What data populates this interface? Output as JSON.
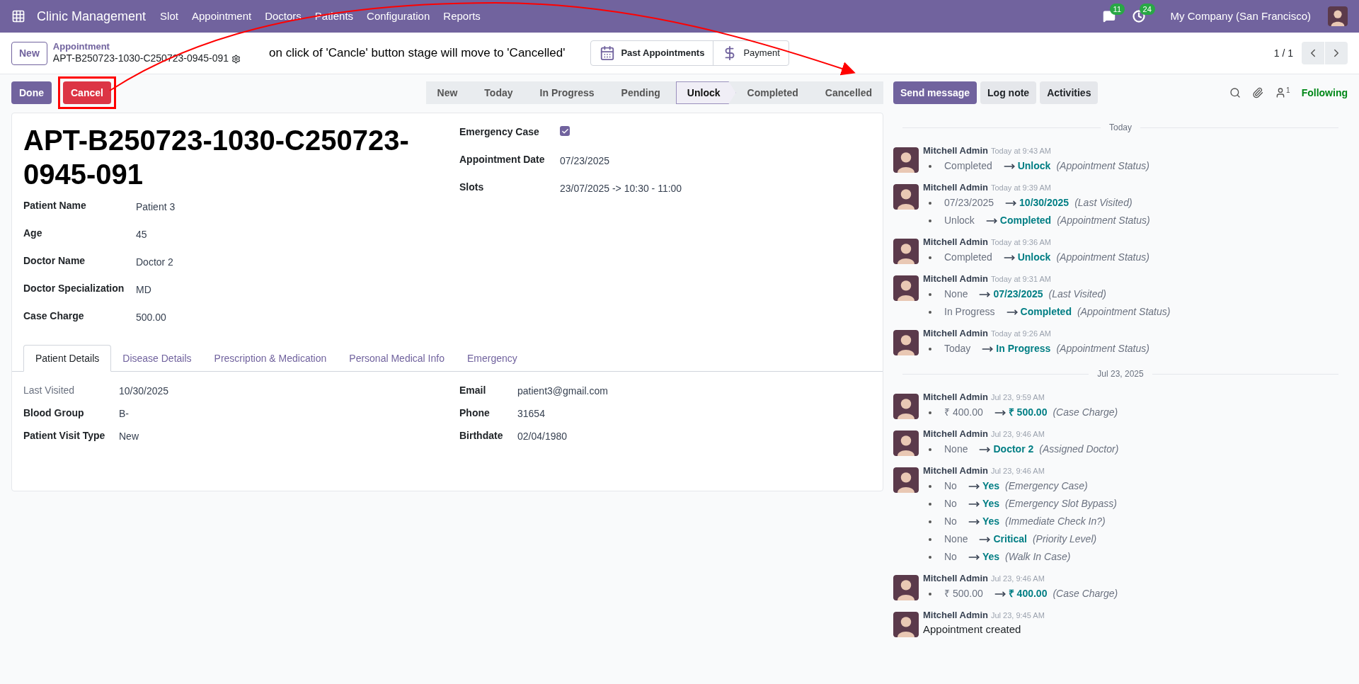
{
  "navbar": {
    "app_name": "Clinic Management",
    "menu": [
      "Slot",
      "Appointment",
      "Doctors",
      "Patients",
      "Configuration",
      "Reports"
    ],
    "messages_count": "11",
    "activities_count": "24",
    "company": "My Company (San Francisco)"
  },
  "breadcrumb": {
    "new_button": "New",
    "parent": "Appointment",
    "record": "APT-B250723-1030-C250723-0945-091"
  },
  "annotation": {
    "text": "on click of 'Cancle' button stage will move to 'Cancelled'"
  },
  "smart_buttons": [
    {
      "label": "Past Appointments",
      "kind": "calendar"
    },
    {
      "label": "Payment",
      "kind": "dollar"
    }
  ],
  "pager": "1 / 1",
  "actions": [
    {
      "label": "Done",
      "kind": "primary",
      "highlighted": false
    },
    {
      "label": "Cancel",
      "kind": "danger",
      "highlighted": true
    }
  ],
  "stages": [
    {
      "label": "New",
      "selected": false
    },
    {
      "label": "Today",
      "selected": false
    },
    {
      "label": "In Progress",
      "selected": false
    },
    {
      "label": "Pending",
      "selected": false
    },
    {
      "label": "Unlock",
      "selected": true
    },
    {
      "label": "Completed",
      "selected": false
    },
    {
      "label": "Cancelled",
      "selected": false
    }
  ],
  "form": {
    "title": "APT-B250723-1030-C250723-0945-091",
    "left_fields": [
      {
        "label": "Patient Name",
        "value": "Patient 3",
        "kind": "text"
      },
      {
        "label": "Age",
        "value": "45",
        "kind": "text"
      },
      {
        "label": "Doctor Name",
        "value": "Doctor 2",
        "kind": "text"
      },
      {
        "label": "Doctor Specialization",
        "value": "MD",
        "kind": "text"
      },
      {
        "label": "Case Charge",
        "value": "500.00",
        "kind": "text"
      }
    ],
    "right_fields": [
      {
        "label": "Emergency Case",
        "kind": "checkbox",
        "checked": true
      },
      {
        "label": "Appointment Date",
        "value": "07/23/2025",
        "kind": "text"
      },
      {
        "label": "Slots",
        "value": "23/07/2025 -> 10:30 - 11:00",
        "kind": "text"
      }
    ],
    "tabs": [
      {
        "label": "Patient Details",
        "selected": true
      },
      {
        "label": "Disease Details",
        "selected": false
      },
      {
        "label": "Prescription & Medication",
        "selected": false
      },
      {
        "label": "Personal Medical Info",
        "selected": false
      },
      {
        "label": "Emergency",
        "selected": false
      }
    ],
    "tab_left_fields": [
      {
        "label": "Last Visited",
        "value": "10/30/2025",
        "muted": true
      },
      {
        "label": "Blood Group",
        "value": "B-",
        "muted": false
      },
      {
        "label": "Patient Visit Type",
        "value": "New",
        "muted": false
      }
    ],
    "tab_right_fields": [
      {
        "label": "Email",
        "value": "patient3@gmail.com",
        "muted": false
      },
      {
        "label": "Phone",
        "value": "31654",
        "muted": false
      },
      {
        "label": "Birthdate",
        "value": "02/04/1980",
        "muted": false
      }
    ]
  },
  "chatter": {
    "buttons": [
      {
        "label": "Send message",
        "kind": "primary"
      },
      {
        "label": "Log note",
        "kind": "secondary"
      },
      {
        "label": "Activities",
        "kind": "secondary"
      }
    ],
    "followers_count": "1",
    "following": "Following",
    "groups": [
      {
        "date": "Today",
        "messages": [
          {
            "author": "Mitchell Admin",
            "time": "Today at 9:43 AM",
            "changes": [
              {
                "old": "Completed",
                "new": "Unlock",
                "field": "(Appointment Status)"
              }
            ]
          },
          {
            "author": "Mitchell Admin",
            "time": "Today at 9:39 AM",
            "changes": [
              {
                "old": "07/23/2025",
                "new": "10/30/2025",
                "field": "(Last Visited)"
              },
              {
                "old": "Unlock",
                "new": "Completed",
                "field": "(Appointment Status)"
              }
            ]
          },
          {
            "author": "Mitchell Admin",
            "time": "Today at 9:36 AM",
            "changes": [
              {
                "old": "Completed",
                "new": "Unlock",
                "field": "(Appointment Status)"
              }
            ]
          },
          {
            "author": "Mitchell Admin",
            "time": "Today at 9:31 AM",
            "changes": [
              {
                "old": "None",
                "new": "07/23/2025",
                "field": "(Last Visited)"
              },
              {
                "old": "In Progress",
                "new": "Completed",
                "field": "(Appointment Status)"
              }
            ]
          },
          {
            "author": "Mitchell Admin",
            "time": "Today at 9:26 AM",
            "changes": [
              {
                "old": "Today",
                "new": "In Progress",
                "field": "(Appointment Status)"
              }
            ]
          }
        ]
      },
      {
        "date": "Jul 23, 2025",
        "messages": [
          {
            "author": "Mitchell Admin",
            "time": "Jul 23, 9:59 AM",
            "changes": [
              {
                "old": "₹ 400.00",
                "new": "₹ 500.00",
                "field": "(Case Charge)"
              }
            ]
          },
          {
            "author": "Mitchell Admin",
            "time": "Jul 23, 9:46 AM",
            "changes": [
              {
                "old": "None",
                "new": "Doctor 2",
                "field": "(Assigned Doctor)"
              }
            ]
          },
          {
            "author": "Mitchell Admin",
            "time": "Jul 23, 9:46 AM",
            "changes": [
              {
                "old": "No",
                "new": "Yes",
                "field": "(Emergency Case)"
              },
              {
                "old": "No",
                "new": "Yes",
                "field": "(Emergency Slot Bypass)"
              },
              {
                "old": "No",
                "new": "Yes",
                "field": "(Immediate Check In?)"
              },
              {
                "old": "None",
                "new": "Critical",
                "field": "(Priority Level)"
              },
              {
                "old": "No",
                "new": "Yes",
                "field": "(Walk In Case)"
              }
            ]
          },
          {
            "author": "Mitchell Admin",
            "time": "Jul 23, 9:46 AM",
            "changes": [
              {
                "old": "₹ 500.00",
                "new": "₹ 400.00",
                "field": "(Case Charge)"
              }
            ]
          },
          {
            "author": "Mitchell Admin",
            "time": "Jul 23, 9:45 AM",
            "body": "Appointment created"
          }
        ]
      }
    ]
  }
}
